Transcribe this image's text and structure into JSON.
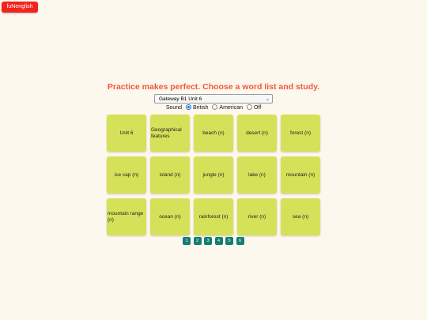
{
  "brand": {
    "label": "fuNenglish",
    "color": "#f2231d"
  },
  "headline": "Practice makes perfect. Choose a word list and study.",
  "word_list_select": {
    "selected": "Gateway B1 Unit 6"
  },
  "sound": {
    "label": "Sound",
    "options": [
      {
        "label": "British",
        "checked": true
      },
      {
        "label": "American",
        "checked": false
      },
      {
        "label": "Off",
        "checked": false
      }
    ]
  },
  "cards": [
    "Unit 6",
    "Geographical features",
    "beach (n)",
    "desert (n)",
    "forest (n)",
    "ice cap (n)",
    "island (n)",
    "jungle (n)",
    "lake (n)",
    "mountain (n)",
    "mountain range (n)",
    "ocean (n)",
    "rainforest (n)",
    "river (n)",
    "sea (n)"
  ],
  "pages": [
    "1",
    "2",
    "3",
    "4",
    "5",
    "6"
  ],
  "colors": {
    "background": "#fdf8ed",
    "headline": "#f1573a",
    "card": "#d5e159",
    "page_button": "#137d76"
  }
}
